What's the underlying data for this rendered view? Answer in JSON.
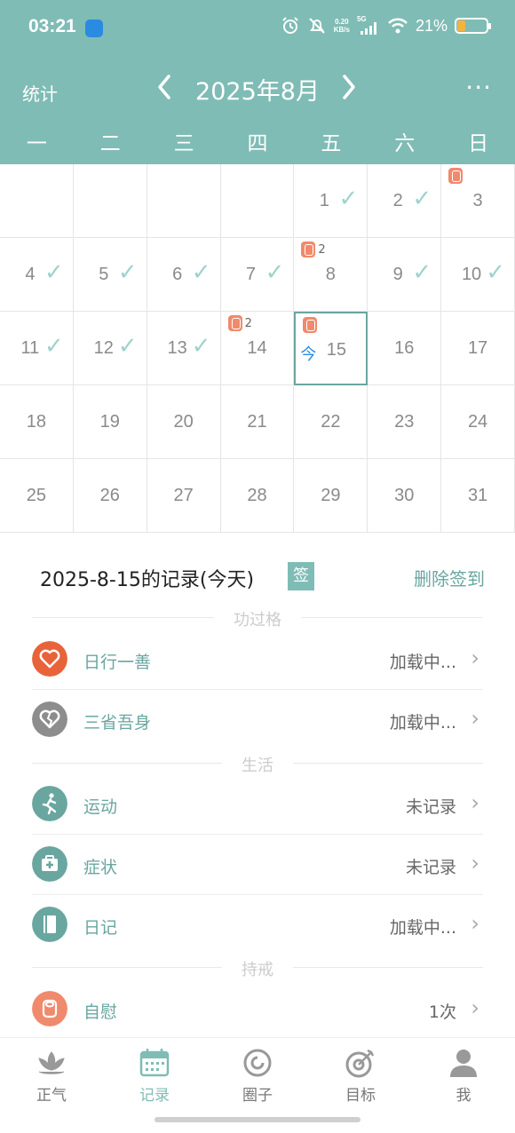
{
  "status_bar": {
    "time": "03:21",
    "net_speed_top": "0.20",
    "net_speed_bottom": "KB/s",
    "network": "5G",
    "battery": "21%"
  },
  "header": {
    "stats_label": "统计",
    "month_title": "2025年8月",
    "prev_icon": "chevron-left-icon",
    "next_icon": "chevron-right-icon",
    "more_icon": "more-icon",
    "more_label": "···",
    "accent_color": "#7fbcb5"
  },
  "weekdays": [
    "一",
    "二",
    "三",
    "四",
    "五",
    "六",
    "日"
  ],
  "calendar": {
    "today_tag": "今",
    "days": [
      {
        "day": "1",
        "checked": true
      },
      {
        "day": "2",
        "checked": true
      },
      {
        "day": "3",
        "badge": true
      },
      {
        "day": "4",
        "checked": true
      },
      {
        "day": "5",
        "checked": true
      },
      {
        "day": "6",
        "checked": true
      },
      {
        "day": "7",
        "checked": true
      },
      {
        "day": "8",
        "badge": true,
        "badge_count": "2"
      },
      {
        "day": "9",
        "checked": true
      },
      {
        "day": "10",
        "checked": true
      },
      {
        "day": "11",
        "checked": true
      },
      {
        "day": "12",
        "checked": true
      },
      {
        "day": "13",
        "checked": true
      },
      {
        "day": "14",
        "badge": true,
        "badge_count": "2"
      },
      {
        "day": "15",
        "badge": true,
        "today": true
      },
      {
        "day": "16"
      },
      {
        "day": "17"
      },
      {
        "day": "18"
      },
      {
        "day": "19"
      },
      {
        "day": "20"
      },
      {
        "day": "21"
      },
      {
        "day": "22"
      },
      {
        "day": "23"
      },
      {
        "day": "24"
      },
      {
        "day": "25"
      },
      {
        "day": "26"
      },
      {
        "day": "27"
      },
      {
        "day": "28"
      },
      {
        "day": "29"
      },
      {
        "day": "30"
      },
      {
        "day": "31"
      }
    ]
  },
  "record": {
    "title": "2025-8-15的记录(今天)",
    "sign_badge": "签",
    "delete_sign": "删除签到",
    "sections": [
      {
        "title": "功过格",
        "rows": [
          {
            "label": "日行一善",
            "value": "加载中...",
            "icon": "heart-icon",
            "color": "#e8633a"
          },
          {
            "label": "三省吾身",
            "value": "加载中...",
            "icon": "broken-heart-icon",
            "color": "#8d8d8d"
          }
        ]
      },
      {
        "title": "生活",
        "rows": [
          {
            "label": "运动",
            "value": "未记录",
            "icon": "running-icon",
            "color": "#6aa6a0"
          },
          {
            "label": "症状",
            "value": "未记录",
            "icon": "medical-kit-icon",
            "color": "#6aa6a0"
          },
          {
            "label": "日记",
            "value": "加载中...",
            "icon": "diary-icon",
            "color": "#6aa6a0"
          }
        ]
      },
      {
        "title": "持戒",
        "rows": [
          {
            "label": "自慰",
            "value": "1次",
            "icon": "tissue-roll-icon",
            "color": "#f08a6c"
          }
        ]
      }
    ]
  },
  "bottom_nav": [
    {
      "label": "正气",
      "icon": "lotus-icon",
      "active": false
    },
    {
      "label": "记录",
      "icon": "calendar-icon",
      "active": true
    },
    {
      "label": "圈子",
      "icon": "circle-icon",
      "active": false
    },
    {
      "label": "目标",
      "icon": "target-icon",
      "active": false
    },
    {
      "label": "我",
      "icon": "user-icon",
      "active": false
    }
  ],
  "colors": {
    "accent": "#7fbcb5",
    "accent_dark": "#6aa6a0",
    "today_blue": "#2a8be0",
    "badge": "#f08a6c"
  }
}
